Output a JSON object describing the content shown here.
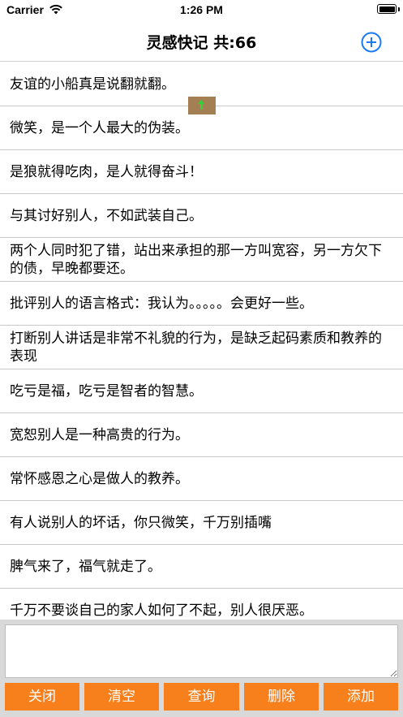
{
  "status_bar": {
    "carrier": "Carrier",
    "time": "1:26 PM"
  },
  "nav": {
    "title": "灵感快记  共:66",
    "add_icon": "plus-circle-icon"
  },
  "items": [
    "友谊的小船真是说翻就翻。",
    "微笑，是一个人最大的伪装。",
    "是狼就得吃肉，是人就得奋斗！",
    "与其讨好别人，不如武装自己。",
    "两个人同时犯了错，站出来承担的那一方叫宽容，另一方欠下的债，早晚都要还。",
    "批评别人的语言格式：我认为。。。。。会更好一些。",
    "打断别人讲话是非常不礼貌的行为，是缺乏起码素质和教养的表现",
    "吃亏是福，吃亏是智者的智慧。",
    "宽恕别人是一种高贵的行为。",
    "常怀感恩之心是做人的教养。",
    "有人说别人的坏话，你只微笑，千万别插嘴",
    "脾气来了，福气就走了。",
    "千万不要谈自己的家人如何了不起，别人很厌恶。"
  ],
  "input": {
    "value": ""
  },
  "buttons": {
    "close": "关闭",
    "clear": "清空",
    "query": "查询",
    "delete": "删除",
    "add": "添加"
  },
  "colors": {
    "accent": "#1a7cf5",
    "button_bg": "#f77f1c",
    "panel_bg": "#d9d9d9",
    "handle": "#a57f54"
  }
}
